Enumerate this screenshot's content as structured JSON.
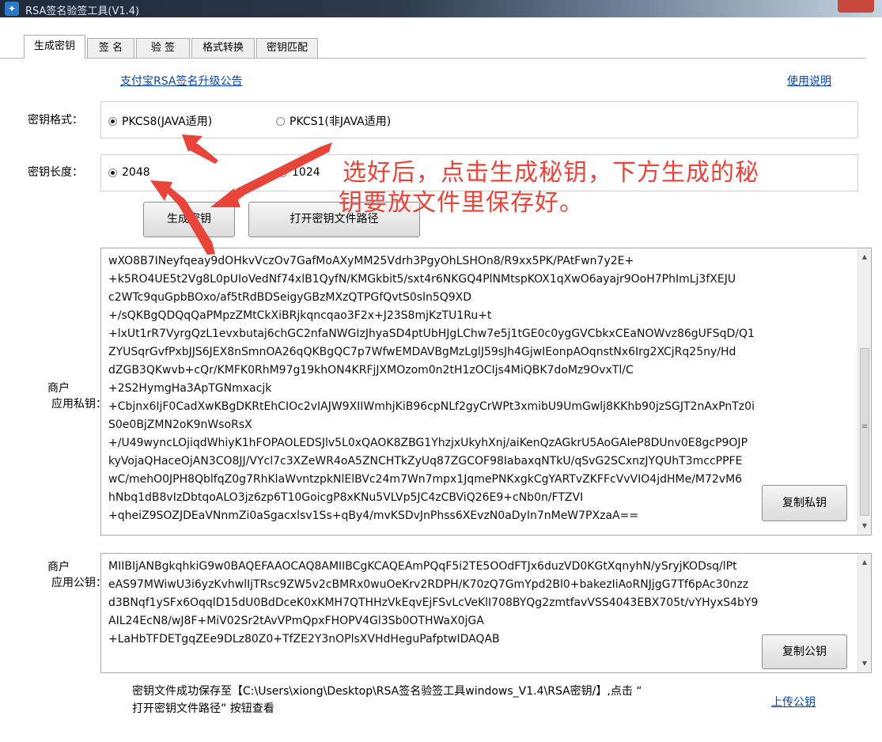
{
  "window": {
    "title": "RSA签名验签工具(V1.4)"
  },
  "tabs": [
    {
      "label": "生成密钥",
      "active": true
    },
    {
      "label": "签 名",
      "active": false
    },
    {
      "label": "验 签",
      "active": false
    },
    {
      "label": "格式转换",
      "active": false
    },
    {
      "label": "密钥匹配",
      "active": false
    }
  ],
  "links": {
    "announcement": "支付宝RSA签名升级公告",
    "usage": "使用说明",
    "upload": "上传公钥"
  },
  "key_format": {
    "label": "密钥格式：",
    "options": [
      {
        "label": "PKCS8(JAVA适用)",
        "checked": true
      },
      {
        "label": "PKCS1(非JAVA适用)",
        "checked": false
      }
    ]
  },
  "key_length": {
    "label": "密钥长度：",
    "options": [
      {
        "label": "2048",
        "checked": true
      },
      {
        "label": "1024",
        "checked": false
      }
    ]
  },
  "buttons": {
    "generate": "生成密钥",
    "open_path": "打开密钥文件路径",
    "copy_private": "复制私钥",
    "copy_public": "复制公钥"
  },
  "private_key": {
    "label_line1": "商户",
    "label_line2": "应用私钥：",
    "lines": [
      "wXO8B7INeyfqeay9dOHkvVczOv7GafMoAXyMM25Vdrh3PgyOhLSHOn8/R9xx5PK/PAtFwn7y2E+",
      "+k5RO4UE5t2Vg8L0pUIoVedNf74xlB1QyfN/KMGkbit5/sxt4r6NKGQ4PlNMtspKOX1qXwO6ayajr9OoH7PhImLj3fXEJU",
      "c2WTc9quGpbBOxo/af5tRdBDSeigyGBzMXzQTPGfQvtS0sln5Q9XD",
      "+/sQKBgQDQqQaPMpzZMtCkXiBRjkqncqao3F2x+J23S8mjKzTU1Ru+t",
      "+lxUt1rR7VyrgQzL1evxbutaj6chGC2nfaNWGIzJhyaSD4ptUbHJgLChw7e5j1tGE0c0ygGVCbkxCEaNOWvz86gUFSqD/Q1",
      "ZYUSqrGvfPxbJJS6JEX8nSmnOA26qQKBgQC7p7WfwEMDAVBgMzLglJ59sJh4GjwIEonpAOqnstNx6Irg2XCjRq25ny/Hd",
      "dZGB3QKwvb+cQr/KMFK0RhM97g19khON4KRFjJXMOzom0n2tH1zOCIjs4MiQBK7doMz9OvxTl/C",
      "+2S2HymgHa3ApTGNmxacjk",
      "+Cbjnx6IjF0CadXwKBgDKRtEhCIOc2vIAJW9XIIWmhjKiB96cpNLf2gyCrWPt3xmibU9UmGwlj8KKhb90jzSGJT2nAxPnTz0i",
      "S0e0BjZMN2oK9nWsoRsX",
      "+/U49wyncLOjiqdWhiyK1hFOPAOLEDSJlv5L0xQAOK8ZBG1YhzjxUkyhXnj/aiKenQzAGkrU5AoGAIeP8DUnv0E8gcP9OJP",
      "kyVojaQHaceOjAN3CO8JJ/VYcl7c3XZeWR4oA5ZNCHTkZyUq87ZGCOF98IabaxqNTkU/qSvG2SCxnzJYQUhT3mccPPFE",
      "wC/mehO0JPH8QblfqZ0g7RhKlaWvntzpkNlElBVc24m7Wn7mpx1JqmePNKxgkCgYARTvZKFFcVvVIO4jdHMe/M72vM6",
      "hNbq1dB8vIzDbtqoALO3jz6zp6T10GoicgP8xKNu5VLVp5JC4zCBViQ26E9+cNb0n/FTZVI",
      "+qheiZ9SOZJDEaVNnmZi0aSgacxlsv1Ss+qBy4/mvKSDvJnPhss6XEvzN0aDyIn7nMeW7PXzaA=="
    ]
  },
  "public_key": {
    "label_line1": "商户",
    "label_line2": "应用公钥：",
    "lines": [
      "MIIBIjANBgkqhkiG9w0BAQEFAAOCAQ8AMIIBCgKCAQEAmPQqF5i2TE5OOdFTJx6duzVD0KGtXqnyhN/ySryjKODsq/lPt",
      "eAS97MWiwU3i6yzKvhwlIjTRsc9ZW5v2cBMRx0wuOeKrv2RDPH/K70zQ7GmYpd2Bl0+bakezIiAoRNJjgG7Tf6pAc30nzz",
      "d3BNqf1ySFx6OqqlD15dU0BdDceK0xKMH7QTHHzVkEqvEjFSvLcVeKlI708BYQg2zmtfavVSS4043EBX705t/vYHyxS4bY9",
      "AIL24EcN8/wJ8F+MiV02Sr2tAvVPmQpxFHOPV4Gl3Sb0OTHWaX0jGA",
      "+LaHbTFDETgqZEe9DLz80Z0+TfZE2Y3nOPlsXVHdHeguPafptwIDAQAB"
    ]
  },
  "status": {
    "line1": "密钥文件成功保存至【C:\\Users\\xiong\\Desktop\\RSA签名验签工具windows_V1.4\\RSA密钥/】,点击 “",
    "line2": "打开密钥文件路径” 按钮查看"
  },
  "annotation": {
    "line1": "选好后，点击生成秘钥，下方生成的秘",
    "line2": "钥要放文件里保存好。",
    "color": "#e8443a"
  },
  "icons": [
    "app-icon",
    "close-icon",
    "scroll-up-icon",
    "scroll-down-icon",
    "red-arrow-icon"
  ]
}
